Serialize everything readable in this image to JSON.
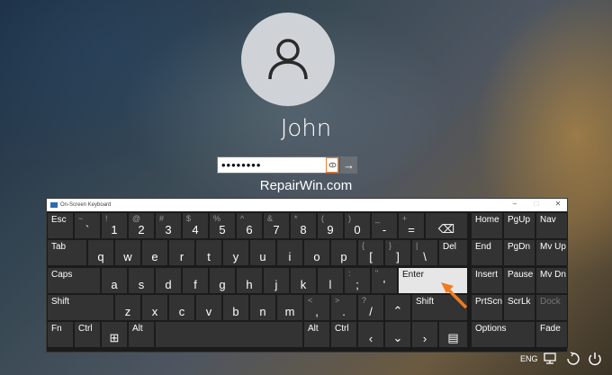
{
  "login": {
    "username": "John",
    "password_masked": "••••••••",
    "reveal_icon": "eye-icon",
    "submit_icon": "arrow-right-icon"
  },
  "watermark": "RepairWin.com",
  "osk": {
    "title": "On-Screen Keyboard",
    "keys": {
      "esc": "Esc",
      "tab": "Tab",
      "caps": "Caps",
      "shift_l": "Shift",
      "fn": "Fn",
      "ctrl_l": "Ctrl",
      "alt_l": "Alt",
      "del": "Del",
      "enter": "Enter",
      "shift_r": "Shift",
      "alt_r": "Alt",
      "ctrl_r": "Ctrl",
      "home": "Home",
      "pgup": "PgUp",
      "nav": "Nav",
      "end": "End",
      "pgdn": "PgDn",
      "mvup": "Mv Up",
      "insert": "Insert",
      "pause": "Pause",
      "mvdn": "Mv Dn",
      "prtscn": "PrtScn",
      "scrlk": "ScrLk",
      "dock": "Dock",
      "options": "Options",
      "fade": "Fade",
      "row1": [
        {
          "sec": "~",
          "pri": "`"
        },
        {
          "sec": "!",
          "pri": "1"
        },
        {
          "sec": "@",
          "pri": "2"
        },
        {
          "sec": "#",
          "pri": "3"
        },
        {
          "sec": "$",
          "pri": "4"
        },
        {
          "sec": "%",
          "pri": "5"
        },
        {
          "sec": "^",
          "pri": "6"
        },
        {
          "sec": "&",
          "pri": "7"
        },
        {
          "sec": "*",
          "pri": "8"
        },
        {
          "sec": "(",
          "pri": "9"
        },
        {
          "sec": ")",
          "pri": "0"
        },
        {
          "sec": "_",
          "pri": "-"
        },
        {
          "sec": "+",
          "pri": "="
        }
      ],
      "row2": [
        {
          "pri": "q"
        },
        {
          "pri": "w"
        },
        {
          "pri": "e"
        },
        {
          "pri": "r"
        },
        {
          "pri": "t"
        },
        {
          "pri": "y"
        },
        {
          "pri": "u"
        },
        {
          "pri": "i"
        },
        {
          "pri": "o"
        },
        {
          "pri": "p"
        },
        {
          "sec": "{",
          "pri": "["
        },
        {
          "sec": "}",
          "pri": "]"
        },
        {
          "sec": "|",
          "pri": "\\"
        }
      ],
      "row3": [
        {
          "pri": "a"
        },
        {
          "pri": "s"
        },
        {
          "pri": "d"
        },
        {
          "pri": "f"
        },
        {
          "pri": "g"
        },
        {
          "pri": "h"
        },
        {
          "pri": "j"
        },
        {
          "pri": "k"
        },
        {
          "pri": "l"
        },
        {
          "sec": ":",
          "pri": ";"
        },
        {
          "sec": "\"",
          "pri": "'"
        }
      ],
      "row4": [
        {
          "pri": "z"
        },
        {
          "pri": "x"
        },
        {
          "pri": "c"
        },
        {
          "pri": "v"
        },
        {
          "pri": "b"
        },
        {
          "pri": "n"
        },
        {
          "pri": "m"
        },
        {
          "sec": "<",
          "pri": ","
        },
        {
          "sec": ">",
          "pri": "."
        },
        {
          "sec": "?",
          "pri": "/"
        }
      ]
    }
  },
  "tray": {
    "language": "ENG"
  }
}
